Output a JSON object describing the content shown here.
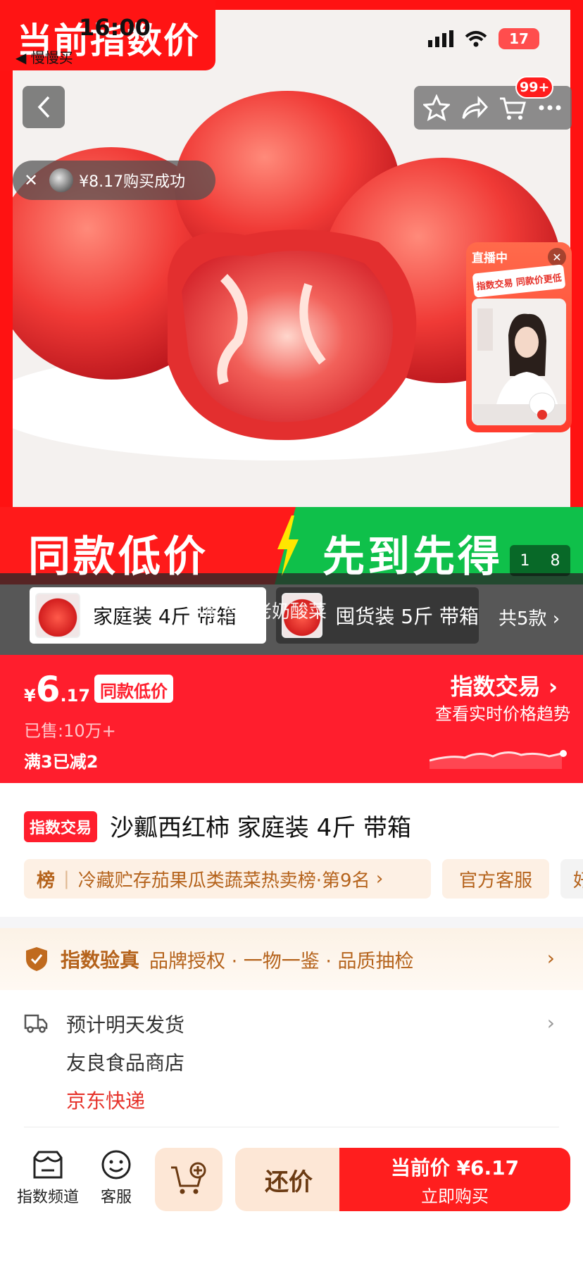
{
  "status_bar": {
    "time": "16:00",
    "back_app": "◀ 慢慢买",
    "battery": "17"
  },
  "hero": {
    "promo_tag": "当前指数价",
    "cart_badge": "99+",
    "toast": {
      "text": "¥8.17购买成功"
    },
    "live": {
      "tag": "直播中",
      "banner": "指数交易 同款价更低"
    },
    "strip_left": "同款低价",
    "strip_right": "先到先得",
    "page_indicator": {
      "current": "1",
      "total": "8"
    }
  },
  "variants": {
    "items": [
      {
        "label": "家庭装 4斤 带箱",
        "selected": true
      },
      {
        "label": "囤货装 5斤 带箱",
        "selected": false
      }
    ],
    "all_label": "共5款",
    "overlay_caption": "嘴上的老奶酸菜"
  },
  "price_bar": {
    "currency": "¥",
    "price_int": "6",
    "price_dec": ".17",
    "price_tag": "同款低价",
    "sold": "已售:10万+",
    "discount": "满3已减2",
    "index_title": "指数交易",
    "index_sub": "查看实时价格趋势"
  },
  "product": {
    "badge": "指数交易",
    "title": "沙瓤西红柿 家庭装 4斤 带箱",
    "rank": {
      "prefix": "榜",
      "text": "冷藏贮存茄果瓜类蔬菜热卖榜·第9名"
    },
    "service": "官方客服",
    "more": "好"
  },
  "verify": {
    "title": "指数验真",
    "items": "品牌授权 · 一物一鉴 · 品质抽检"
  },
  "delivery": {
    "ship_date": "预计明天发货",
    "shop_name": "友良食品商店",
    "courier": "京东快递"
  },
  "bottom_bar": {
    "index_channel": "指数频道",
    "customer_service": "客服",
    "bargain": "还价",
    "buy_price": "当前价 ¥6.17",
    "buy_now": "立即购买"
  },
  "colors": {
    "brand_red": "#ff1e2d",
    "promo_green": "#0fc04a",
    "accent_brown": "#b5631c"
  }
}
